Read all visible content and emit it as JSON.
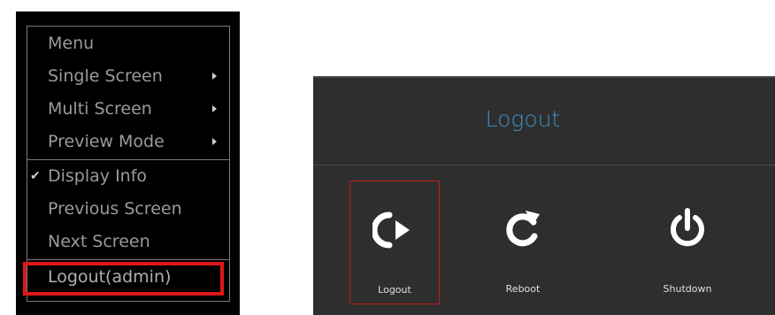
{
  "context_menu": {
    "items": [
      {
        "label": "Menu"
      },
      {
        "label": "Single Screen"
      },
      {
        "label": "Multi Screen"
      },
      {
        "label": "Preview Mode"
      },
      {
        "label": "Display Info"
      },
      {
        "label": "Previous Screen"
      },
      {
        "label": "Next Screen"
      },
      {
        "label": "Logout(admin)"
      }
    ]
  },
  "dialog": {
    "title": "Logout",
    "actions": [
      {
        "label": "Logout",
        "icon": "logout-icon"
      },
      {
        "label": "Reboot",
        "icon": "reboot-icon"
      },
      {
        "label": "Shutdown",
        "icon": "power-icon"
      }
    ]
  },
  "colors": {
    "highlight": "#e01818",
    "title": "#3f8fc4",
    "dialog_bg": "#2e2e2e"
  }
}
